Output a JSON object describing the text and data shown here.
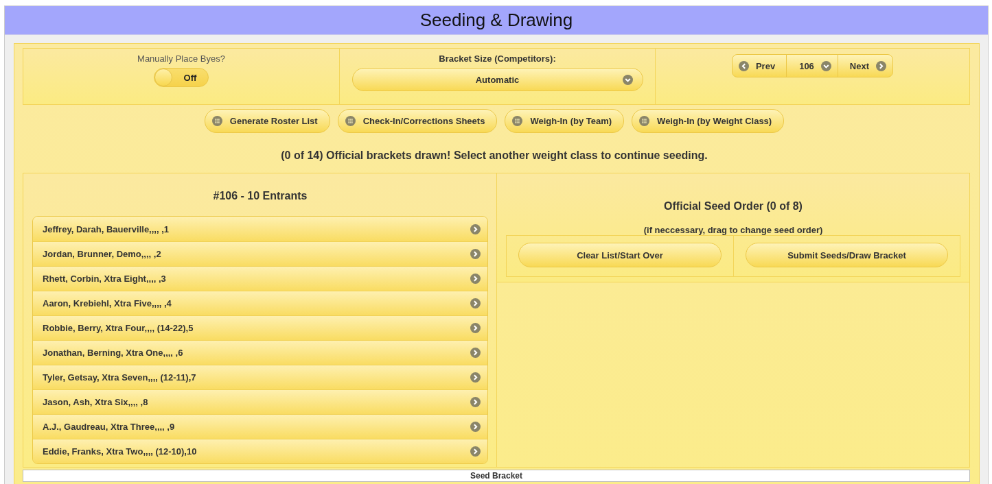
{
  "header": {
    "title": "Seeding & Drawing"
  },
  "byes": {
    "label": "Manually Place Byes?",
    "toggle": {
      "on": false,
      "text": "Off"
    }
  },
  "bracket_size": {
    "label": "Bracket Size (Competitors):",
    "value": "Automatic"
  },
  "pager": {
    "prev": "Prev",
    "current": "106",
    "next": "Next"
  },
  "report_buttons": [
    "Generate Roster List",
    "Check-In/Corrections Sheets",
    "Weigh-In (by Team)",
    "Weigh-In (by Weight Class)"
  ],
  "message": "(0 of 14) Official brackets drawn! Select another weight class to continue seeding.",
  "entrants": {
    "title": "#106 - 10 Entrants",
    "items": [
      "Jeffrey, Darah, Bauerville,,,, ,1",
      "Jordan, Brunner, Demo,,,, ,2",
      "Rhett, Corbin, Xtra Eight,,,, ,3",
      "Aaron, Krebiehl, Xtra Five,,,, ,4",
      "Robbie, Berry, Xtra Four,,,, (14-22),5",
      "Jonathan, Berning, Xtra One,,,, ,6",
      "Tyler, Getsay, Xtra Seven,,,, (12-11),7",
      "Jason, Ash, Xtra Six,,,, ,8",
      "A.J., Gaudreau, Xtra Three,,,, ,9",
      "Eddie, Franks, Xtra Two,,,, (12-10),10"
    ]
  },
  "seed_order": {
    "title": "Official Seed Order (0 of 8)",
    "hint": "(if neccessary, drag to change seed order)",
    "buttons": [
      "Clear List/Start Over",
      "Submit Seeds/Draw Bracket"
    ]
  },
  "footer": {
    "label": "Seed Bracket"
  }
}
